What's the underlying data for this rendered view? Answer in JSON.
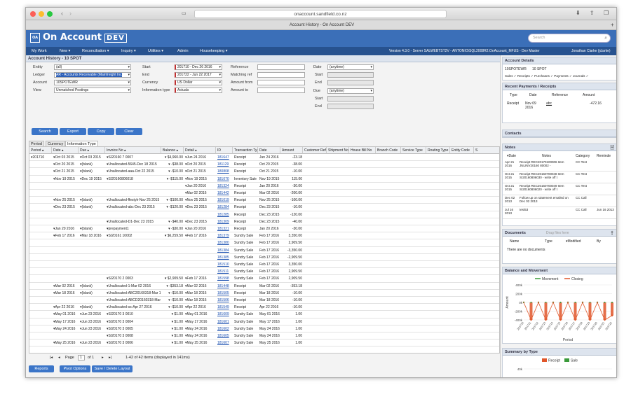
{
  "browser": {
    "url": "onaccount.sandfield.co.nz",
    "tab_title": "Account History - On Account DEV"
  },
  "app": {
    "logo_box": "OA",
    "logo_text": "On Account",
    "logo_badge": "DEV",
    "search_placeholder": "Search"
  },
  "menu": {
    "items": [
      "My Work",
      "New ▾",
      "Reconciliation ▾",
      "Inquiry ▾",
      "Utilities ▾",
      "Admin",
      "Housekeeping ▾"
    ],
    "version": "Version 4.3.0 - Server SALWEBTST2V - ANTONIO\\SQL2008R2.OnAccount_MFUS - Dev Master",
    "user": "Jonathan Clarke (jclarke)"
  },
  "page": {
    "title": "Account History - 10 SPOT"
  },
  "filters": {
    "entity_label": "Entity",
    "entity": "(all)",
    "ledger_label": "Ledger",
    "ledger": "AR - Accounts Receivable (Mainfreight Inc",
    "account_label": "Account",
    "account": "10SPOTEWR",
    "view_label": "View",
    "view": "Unmatched Postings",
    "start_label": "Start",
    "start": "201710 - Dec 26 2016",
    "end_label": "End",
    "end": "201722 - Jun 22 2017",
    "currency_label": "Currency",
    "currency": "US Dollar",
    "infotype_label": "Information type",
    "infotype": "Actuals",
    "reference_label": "Reference",
    "matching_label": "Matching ref",
    "amount_from_label": "Amount from",
    "amount_to_label": "Amount to",
    "date_label": "Date",
    "date": "(anytime)",
    "date_start_label": "Start",
    "date_end_label": "End",
    "due_label": "Due",
    "due": "(anytime)",
    "due_start_label": "Start",
    "due_end_label": "End"
  },
  "buttons": {
    "search": "Search",
    "export": "Export",
    "copy": "Copy",
    "clear": "Clear",
    "reports": "Reports",
    "pivot": "Pivot Options",
    "save_layout": "Save / Delete Layout"
  },
  "tabs": [
    "Period",
    "Currency",
    "Information Type"
  ],
  "grid": {
    "headers": [
      "Period ▴",
      "Date ▴",
      "Due ▴",
      "Invoice No ▴",
      "Balance ▴",
      "Detail ▴",
      "ID",
      "Transaction Type",
      "Date",
      "Amount",
      "Customer Ref",
      "Shipment No",
      "House Bill No",
      "Branch Code",
      "Service Type",
      "Routing Type",
      "Entity Code",
      "S"
    ],
    "rows": [
      [
        "▾201710",
        "▾Oct 03 2015",
        "▾Oct 03 2015",
        "▾SI20160 7 0007",
        "▾ $4,960.00",
        "▾Jun 24 2016",
        "181647",
        "Receipt",
        "Jun 24 2016",
        "-23.18"
      ],
      [
        "",
        "▾Oct 20 2015",
        "▾(blank)",
        "▾Unallocated-5645-Dec 18 2015",
        "▾ -$38.00",
        "▾Oct 20 2015",
        "181129",
        "Receipt",
        "Oct 20 2015",
        "-38.00"
      ],
      [
        "",
        "▾Oct 21 2015",
        "▾(blank)",
        "▾Unallocated-aaa-Oct 22 2015",
        "▾ -$10.00",
        "▾Oct 21 2015",
        "180808",
        "Receipt",
        "Oct 21 2015",
        "-10.00"
      ],
      [
        "",
        "▾Nov 19 2015",
        "▾Dec 19 2015",
        "▾SI20160806018",
        "▾ -$115.00",
        "▾Nov 19 2015",
        "181070",
        "Inventory Sale",
        "Nov 19 2015",
        "115.00"
      ],
      [
        "",
        "",
        "",
        "",
        "",
        "▾Jan 20 2016",
        "181324",
        "Receipt",
        "Jan 20 2016",
        "-30.00"
      ],
      [
        "",
        "",
        "",
        "",
        "",
        "▾Mar 02 2016",
        "181442",
        "Receipt",
        "Mar 02 2016",
        "-200.00"
      ],
      [
        "",
        "▾Nov 25 2015",
        "▾(blank)",
        "▾Unallocated-ffestyh-Nov 25 2015",
        "▾ -$100.00",
        "▾Nov 25 2015",
        "181019",
        "Receipt",
        "Nov 25 2015",
        "-100.00"
      ],
      [
        "",
        "▾Dec 23 2015",
        "▾(blank)",
        "▾Unallocated-abc-Dec 23 2015",
        "▾ -$120.00",
        "▾Dec 23 2015",
        "181284",
        "Receipt",
        "Dec 23 2015",
        "-10.00"
      ],
      [
        "",
        "",
        "",
        "",
        "",
        "",
        "181285",
        "Receipt",
        "Dec 23 2015",
        "-120.00"
      ],
      [
        "",
        "",
        "",
        "▾Unallocated-D1-Dec 23 2015",
        "▾ -$40.00",
        "▾Dec 23 2015",
        "181309",
        "Receipt",
        "Dec 23 2015",
        "-40.00"
      ],
      [
        "",
        "▾Jan 20 2016",
        "▾(blank)",
        "▾prepayment1",
        "▾ -$30.00",
        "▾Jan 20 2016",
        "181321",
        "Receipt",
        "Jan 20 2016",
        "-30.00"
      ],
      [
        "",
        "▾Feb 17 2016",
        "▾Mar 18 2016",
        "▾SI20161 10002",
        "▾ $6,259.50",
        "▾Feb 17 2016",
        "181379",
        "Sundry Sale",
        "Feb 17 2016",
        "3,350.00"
      ],
      [
        "",
        "",
        "",
        "",
        "",
        "",
        "181380",
        "Sundry Sale",
        "Feb 17 2016",
        "2,909.50"
      ],
      [
        "",
        "",
        "",
        "",
        "",
        "",
        "181384",
        "Sundry Sale",
        "Feb 17 2016",
        "-3,350.00"
      ],
      [
        "",
        "",
        "",
        "",
        "",
        "",
        "181385",
        "Sundry Sale",
        "Feb 17 2016",
        "-2,909.50"
      ],
      [
        "",
        "",
        "",
        "",
        "",
        "",
        "181510",
        "Sundry Sale",
        "Feb 17 2016",
        "3,350.00"
      ],
      [
        "",
        "",
        "",
        "",
        "",
        "",
        "181511",
        "Sundry Sale",
        "Feb 17 2016",
        "2,909.50"
      ],
      [
        "",
        "",
        "",
        "▾SI20170 2 0003",
        "▾ $2,909.50",
        "▾Feb 17 2016",
        "181598",
        "Sundry Sale",
        "Feb 17 2016",
        "2,909.50"
      ],
      [
        "",
        "▾Mar 02 2016",
        "▾(blank)",
        "▾Unallocated-1-Mar 02 2016",
        "▾ -$353.18",
        "▾Mar 02 2016",
        "181448",
        "Receipt",
        "Mar 02 2016",
        "-353.18"
      ],
      [
        "",
        "▾Mar 18 2016",
        "▾(blank)",
        "▾Unallocated-ABC20160318-Mar 18 2016",
        "▾ -$10.00",
        "▾Mar 18 2016",
        "181505",
        "Receipt",
        "Mar 18 2016",
        "-10.00"
      ],
      [
        "",
        "",
        "",
        "▾Unallocated-ABCD20160318-Mar 18 2016",
        "▾ -$10.00",
        "▾Mar 18 2016",
        "181506",
        "Receipt",
        "Mar 18 2016",
        "-10.00"
      ],
      [
        "",
        "▾Apr 22 2016",
        "▾(blank)",
        "▾Unallocated-ss-Apr 27 2016",
        "▾ -$10.00",
        "▾Apr 22 2016",
        "181549",
        "Receipt",
        "Apr 22 2016",
        "-10.00"
      ],
      [
        "",
        "▾May 01 2016",
        "▾Jun 23 2016",
        "▾SI20170 3 0010",
        "▾ $1.00",
        "▾May 01 2016",
        "181609",
        "Sundry Sale",
        "May 01 2016",
        "1.00"
      ],
      [
        "",
        "▾May 17 2016",
        "▾Jun 23 2016",
        "▾SI20170 3 0004",
        "▾ $1.00",
        "▾May 17 2016",
        "181601",
        "Sundry Sale",
        "May 17 2016",
        "1.00"
      ],
      [
        "",
        "▾May 24 2016",
        "▾Jun 23 2016",
        "▾SI20170 3 0005",
        "▾ $1.00",
        "▾May 24 2016",
        "181602",
        "Sundry Sale",
        "May 24 2016",
        "1.00"
      ],
      [
        "",
        "",
        "",
        "▾SI20170 3 0008",
        "▾ $1.00",
        "▾May 24 2016",
        "181605",
        "Sundry Sale",
        "May 24 2016",
        "1.00"
      ],
      [
        "",
        "▾May 25 2016",
        "▾Jun 23 2016",
        "▾SI20170 3 0006",
        "▾ $1.00",
        "▾May 25 2016",
        "181607",
        "Sundry Sale",
        "May 25 2016",
        "1.00"
      ]
    ]
  },
  "pager": {
    "page_label": "Page",
    "page": "1",
    "of": "of 1",
    "summary": "1-42 of 42 items (displayed in 141ms)"
  },
  "side": {
    "details_title": "Account Details",
    "details_code": "10SPOTEWR",
    "details_name": "10 SPOT",
    "details_flags": "Sales ✓  Receipts ✓  Purchases ✓  Payments ✓  Journals ✓",
    "recent_title": "Recent Payments / Receipts",
    "recent_headers": [
      "Type",
      "Date",
      "Reference",
      "Amount"
    ],
    "recent_row": [
      "Receipt",
      "Nov 09 2016",
      "abc",
      "-472.16"
    ],
    "contacts_title": "Contacts",
    "notes_title": "Notes",
    "notes_headers": [
      "▾Date",
      "Notes",
      "Category",
      "Reminde"
    ],
    "notes": [
      [
        "Apr 21 2016",
        "Receipt REC20170100006 Item JNLINV20160 80002 -",
        "CC Test",
        ""
      ],
      [
        "Oct 21 2015",
        "Receipt REC20160700048 Item SI20160806030 - write off t",
        "CC Test",
        ""
      ],
      [
        "Oct 21 2015",
        "Receipt REC20160700049 Item SI20160806020 - write off t",
        "CC Test",
        ""
      ],
      [
        "Dec 02 2013",
        "Follow up on statement emailed on Dec 02 2013",
        "CC Call",
        ""
      ],
      [
        "Jul 16 2013",
        "test53",
        "CC Call",
        "Jun 16 2013"
      ]
    ],
    "documents_title": "Documents",
    "documents_drag": "Drag files here",
    "documents_headers": [
      "Name",
      "Type",
      "▾Modified",
      "By"
    ],
    "documents_empty": "There are no documents",
    "balance_title": "Balance and Movement",
    "legend_movement": "Movement",
    "legend_closing": "Closing",
    "axis_ylabel": "Amount",
    "axis_xlabel": "Period",
    "summary_title": "Summary by Type",
    "legend_receipt": "Receipt",
    "legend_sale": "Sale",
    "summary_tick": "40k"
  },
  "chart_data": [
    {
      "type": "bar",
      "title": "Balance and Movement",
      "xlabel": "Period",
      "ylabel": "Amount",
      "categories": [
        "201710",
        "201711",
        "201712",
        "201713",
        "201714",
        "201715",
        "201716",
        "201717",
        "201718",
        "201719",
        "201720",
        "201721",
        "201722"
      ],
      "series": [
        {
          "name": "Movement",
          "values": [
            0,
            0,
            0,
            0,
            0,
            0,
            0,
            0,
            0,
            0,
            0,
            0,
            0
          ]
        },
        {
          "name": "Closing",
          "values": [
            0,
            -400000,
            0,
            -400000,
            0,
            -400000,
            0,
            -400000,
            0,
            -400000,
            0,
            -400000,
            -300000
          ]
        }
      ],
      "yticks": [
        "400k",
        "200k",
        "0k",
        "-200k",
        "-400k"
      ],
      "ylim": [
        -400000,
        400000
      ],
      "colors": {
        "Movement": "#3a9a3a",
        "Closing": "#e0562a"
      }
    },
    {
      "type": "bar",
      "title": "Summary by Type",
      "series": [
        {
          "name": "Receipt"
        },
        {
          "name": "Sale"
        }
      ],
      "yticks": [
        "40k"
      ],
      "colors": {
        "Receipt": "#e0562a",
        "Sale": "#3a9a3a"
      }
    }
  ]
}
